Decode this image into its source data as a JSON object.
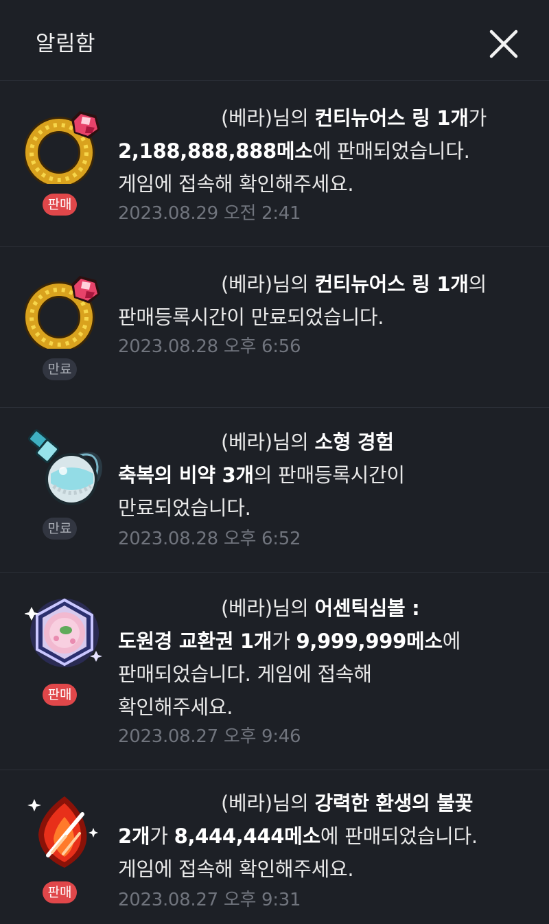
{
  "header": {
    "title": "알림함",
    "close_icon": "close-icon"
  },
  "notifications": [
    {
      "icon": "ring-icon",
      "badge": "판매",
      "badge_type": "sold",
      "server": "(베라)",
      "t1": "님의 ",
      "item": "컨티뉴어스 링 1개",
      "t2": "가",
      "price": "2,188,888,888메소",
      "t3": "에 판매되었습니다.",
      "t4": "게임에 접속해 확인해주세요.",
      "time": "2023.08.29 오전 2:41"
    },
    {
      "icon": "ring-icon",
      "badge": "만료",
      "badge_type": "expired",
      "server": "(베라)",
      "t1": "님의 ",
      "item": "컨티뉴어스 링 1개",
      "t2": "의",
      "t3": "판매등록시간이 만료되었습니다.",
      "time": "2023.08.28 오후 6:56"
    },
    {
      "icon": "potion-icon",
      "badge": "만료",
      "badge_type": "expired",
      "server": "(베라)",
      "t1": "님의 ",
      "item_a": "소형 경험",
      "item_b": "축복의 비약 3개",
      "t2": "의 판매등록시간이",
      "t3": "만료되었습니다.",
      "time": "2023.08.28 오후 6:52"
    },
    {
      "icon": "symbol-icon",
      "badge": "판매",
      "badge_type": "sold",
      "server": "(베라)",
      "t1": "님의 ",
      "item_a": "어센틱심볼 :",
      "item_b": "도원경 교환권 1개",
      "t2": "가 ",
      "price": "9,999,999메소",
      "t3": "에",
      "t4": "판매되었습니다. 게임에 접속해",
      "t5": "확인해주세요.",
      "time": "2023.08.27 오후 9:46"
    },
    {
      "icon": "flame-icon",
      "badge": "판매",
      "badge_type": "sold",
      "server": "(베라)",
      "t1": "님의 ",
      "item_a": "강력한 환생의 불꽃",
      "item_b": "2개",
      "t2": "가 ",
      "price": "8,444,444메소",
      "t3": "에 판매되었습니다.",
      "t4": "게임에 접속해 확인해주세요.",
      "time": "2023.08.27 오후 9:31"
    }
  ],
  "colors": {
    "background": "#1d2026",
    "sold_badge": "#e0474a",
    "expired_badge": "#323641",
    "timestamp": "#70747d"
  }
}
